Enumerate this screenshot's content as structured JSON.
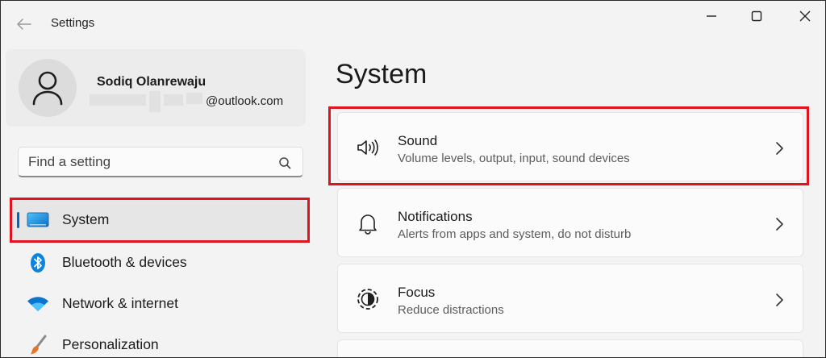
{
  "window": {
    "title": "Settings"
  },
  "profile": {
    "name": "Sodiq Olanrewaju",
    "email": "@outlook.com"
  },
  "search": {
    "placeholder": "Find a setting"
  },
  "nav": {
    "items": [
      {
        "label": "System",
        "icon": "monitor-icon",
        "selected": true
      },
      {
        "label": "Bluetooth & devices",
        "icon": "bluetooth-icon",
        "selected": false
      },
      {
        "label": "Network & internet",
        "icon": "wifi-icon",
        "selected": false
      },
      {
        "label": "Personalization",
        "icon": "brush-icon",
        "selected": false
      }
    ]
  },
  "main": {
    "title": "System",
    "cards": [
      {
        "title": "Sound",
        "desc": "Volume levels, output, input, sound devices",
        "icon": "speaker-icon"
      },
      {
        "title": "Notifications",
        "desc": "Alerts from apps and system, do not disturb",
        "icon": "bell-icon"
      },
      {
        "title": "Focus",
        "desc": "Reduce distractions",
        "icon": "focus-icon"
      }
    ]
  },
  "colors": {
    "accent": "#0067c0",
    "highlight": "#e0141e",
    "background": "#f3f3f3",
    "card": "#fbfbfb"
  }
}
